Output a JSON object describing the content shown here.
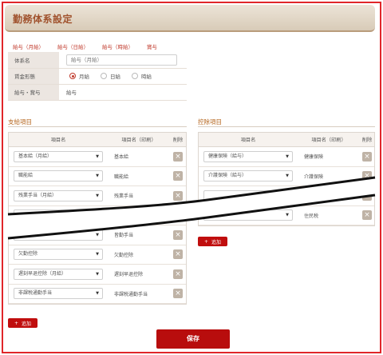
{
  "title": "勤務体系設定",
  "tabs": [
    "給与（月給）",
    "給与（日給）",
    "給与（時給）",
    "賞与"
  ],
  "form": {
    "name_label": "体系名",
    "name_value": "給与（月給）",
    "wage_type_label": "賃金形態",
    "wage_options": [
      "月給",
      "日給",
      "時給"
    ],
    "wage_selected": "月給",
    "category_label": "給与・賞与",
    "category_value": "給与"
  },
  "payment": {
    "section_title": "支給項目",
    "headers": {
      "name": "項目名",
      "print": "項目名（印刷）",
      "delete": "削除"
    },
    "rows": [
      {
        "name": "基本給（月給）",
        "print": "基本給"
      },
      {
        "name": "職能給",
        "print": "職能給"
      },
      {
        "name": "残業手当（月給）",
        "print": "残業手当"
      },
      {
        "name": "",
        "print": ""
      },
      {
        "name": "皆勤手当",
        "print": "皆勤手当"
      },
      {
        "name": "欠勤控除",
        "print": "欠勤控除"
      },
      {
        "name": "遅刻早退控除（月給）",
        "print": "遅刻早退控除"
      },
      {
        "name": "非課税通勤手当",
        "print": "非課税通勤手当"
      }
    ],
    "add_label": "追加"
  },
  "deduction": {
    "section_title": "控除項目",
    "headers": {
      "name": "項目名",
      "print": "項目名（印刷）",
      "delete": "削除"
    },
    "rows": [
      {
        "name": "健康保険（給与）",
        "print": "健康保険"
      },
      {
        "name": "介護保険（給与）",
        "print": "介護保険"
      },
      {
        "name": "",
        "print": ""
      },
      {
        "name": "住民税",
        "print": "住民税"
      }
    ],
    "add_label": "追加"
  },
  "save_label": "保存",
  "colors": {
    "accent": "#b80d0d",
    "title_text": "#a0522d",
    "frame": "#e0262a"
  },
  "icons": {
    "delete": "close-icon",
    "add": "plus-icon",
    "dropdown": "caret-down-icon"
  }
}
